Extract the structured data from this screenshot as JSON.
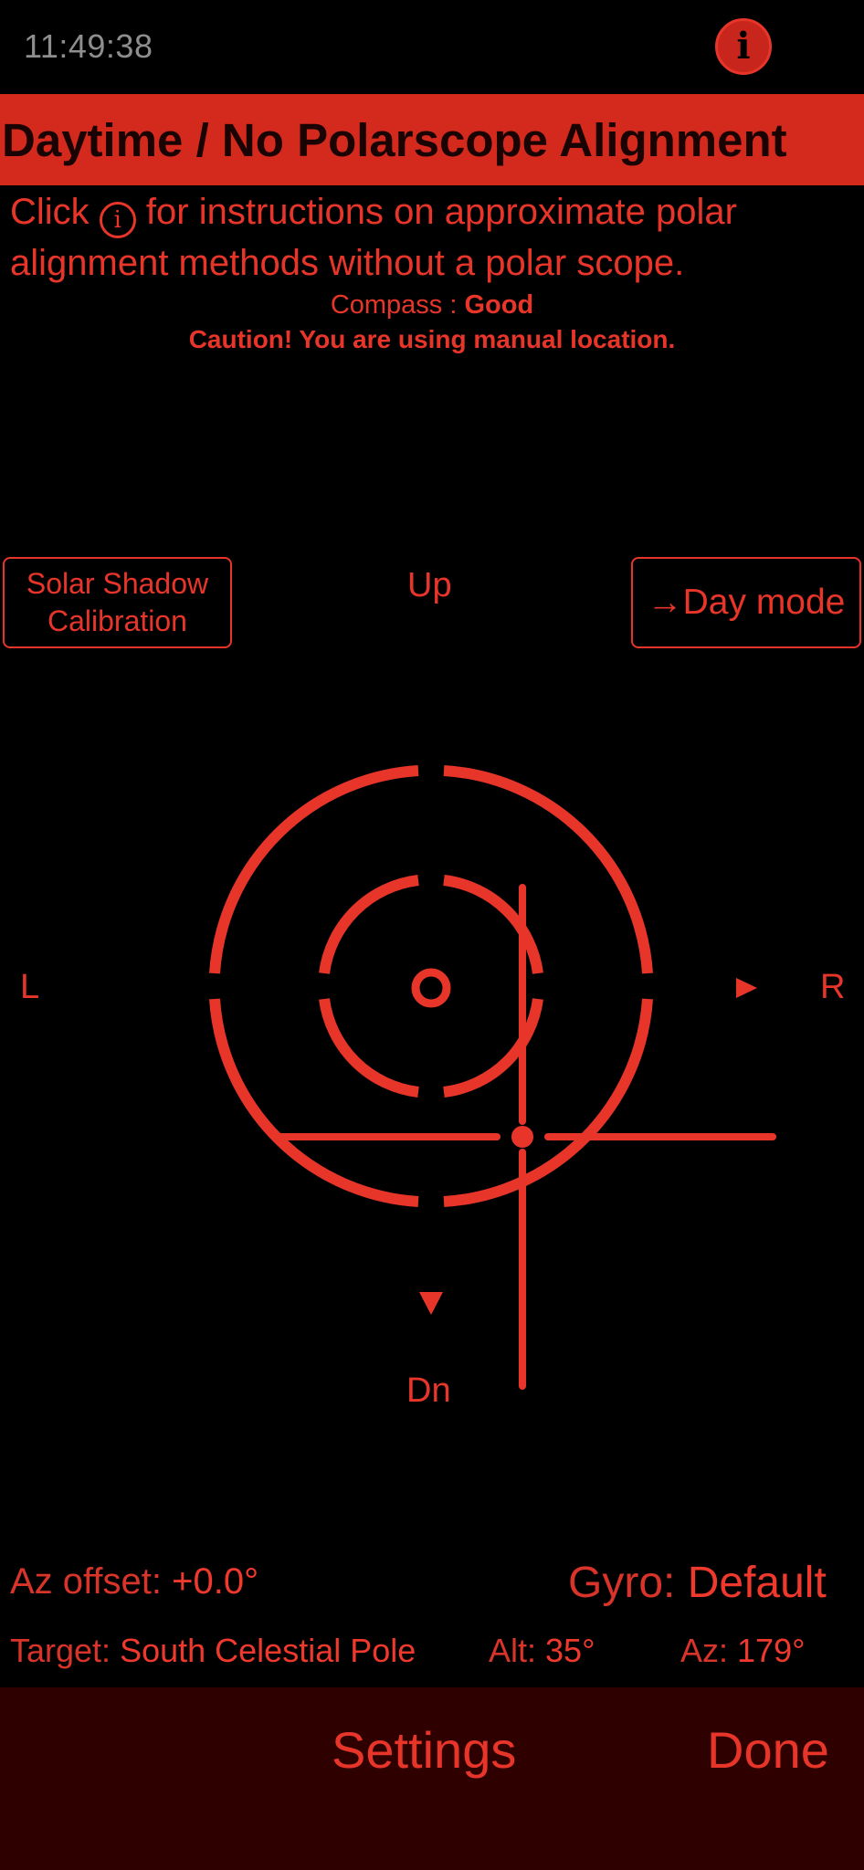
{
  "status_bar": {
    "time": "11:49:38",
    "info_icon": "info-circle-icon"
  },
  "banner": {
    "title": "Daytime / No Polarscope Alignment"
  },
  "instructions": {
    "before_icon": "Click",
    "icon_glyph": "i",
    "after_icon": "for instructions on approximate polar alignment methods without a polar scope."
  },
  "compass": {
    "label": "Compass :",
    "value": "Good"
  },
  "caution": "Caution! You are using manual location.",
  "buttons": {
    "solar_line1": "Solar Shadow",
    "solar_line2": "Calibration",
    "day_mode": "→Day mode"
  },
  "directions": {
    "up": "Up",
    "left": "L",
    "right": "R",
    "down": "Dn"
  },
  "readouts": {
    "az_offset_label": "Az offset:",
    "az_offset_value": "+0.0°",
    "gyro_label": "Gyro:",
    "gyro_value": "Default",
    "target_label": "Target:",
    "target_value": "South Celestial Pole",
    "alt_label": "Alt:",
    "alt_value": "35°",
    "az_label": "Az:",
    "az_value": "179°"
  },
  "toolbar": {
    "settings": "Settings",
    "done": "Done"
  },
  "colors": {
    "accent": "#e8352a",
    "banner": "#d42a1e",
    "toolbar": "#2e0000",
    "background": "#000000"
  }
}
